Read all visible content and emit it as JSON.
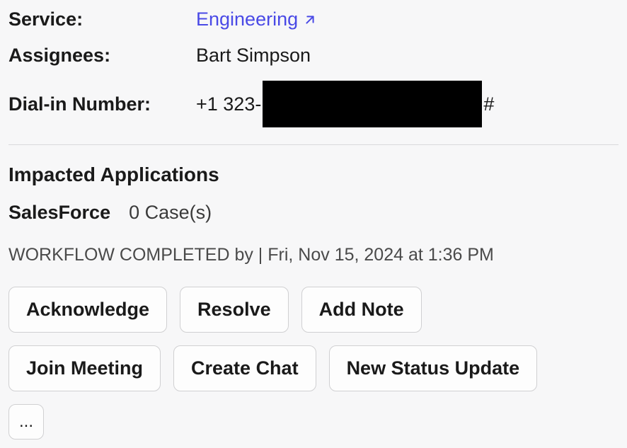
{
  "meta": {
    "service_label": "Service:",
    "service_value": "Engineering",
    "assignees_label": "Assignees:",
    "assignees_value": "Bart Simpson",
    "dialin_label": "Dial-in Number:",
    "dialin_prefix": "+1 323-",
    "dialin_suffix": "#"
  },
  "impacted": {
    "heading": "Impacted Applications",
    "app": "SalesForce",
    "cases": "0 Case(s)"
  },
  "workflow": {
    "status": "WORKFLOW COMPLETED by | Fri, Nov 15, 2024 at 1:36 PM"
  },
  "buttons": {
    "acknowledge": "Acknowledge",
    "resolve": "Resolve",
    "add_note": "Add Note",
    "join_meeting": "Join Meeting",
    "create_chat": "Create Chat",
    "new_status_update": "New Status Update",
    "more": "..."
  }
}
